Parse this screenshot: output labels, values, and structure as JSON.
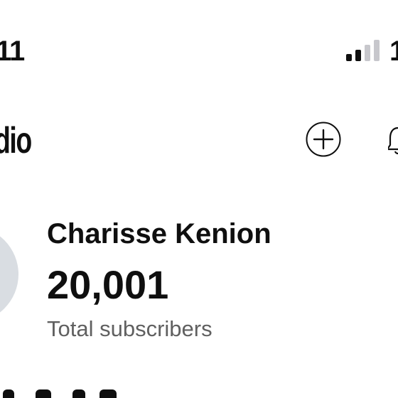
{
  "status_bar": {
    "time": "11",
    "battery_percent": "1",
    "signal_bars_active": 2,
    "signal_bars_total": 4
  },
  "header": {
    "title": "dio",
    "create_icon": "plus-circle-icon",
    "notifications_icon": "bell-icon"
  },
  "channel": {
    "name": "Charisse Kenion",
    "subscriber_count": "20,001",
    "subscriber_label": "Total subscribers"
  },
  "colors": {
    "text": "#0f0f0f",
    "secondary_text": "#606060",
    "avatar_placeholder": "#d9dde2",
    "signal_inactive": "#c7c7cc"
  }
}
